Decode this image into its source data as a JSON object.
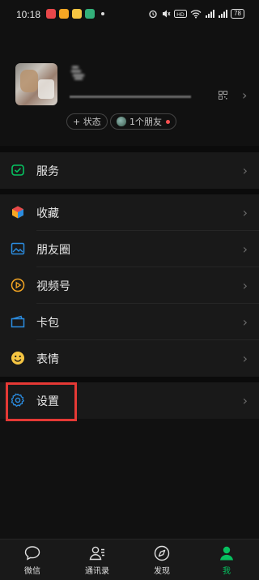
{
  "status_bar": {
    "time": "10:18",
    "battery": "78",
    "app_icon_colors": [
      "#e8474a",
      "#f5a623",
      "#f5c542",
      "#33b07a"
    ],
    "right_icons": [
      "alarm-icon",
      "mute-icon",
      "hd-icon",
      "wifi-icon",
      "signal-icon",
      "signal-icon",
      "battery-icon"
    ]
  },
  "profile": {
    "nickname": "",
    "wechat_id": "",
    "status_label": "+ 状态",
    "friends_label": "1个朋友",
    "unread_dot_color": "#fa5151"
  },
  "menu": {
    "services": {
      "label": "服务",
      "icon": "services-icon",
      "color": "#07c160"
    },
    "favorites": {
      "label": "收藏",
      "icon": "favorites-cube-icon"
    },
    "moments": {
      "label": "朋友圈",
      "icon": "moments-image-icon",
      "color": "#2b8ce0"
    },
    "channels": {
      "label": "视频号",
      "icon": "channels-play-icon",
      "color": "#f5a623"
    },
    "cards": {
      "label": "卡包",
      "icon": "card-wallet-icon",
      "color": "#2b8ce0"
    },
    "stickers": {
      "label": "表情",
      "icon": "sticker-smile-icon",
      "color": "#f5c542"
    },
    "settings": {
      "label": "设置",
      "icon": "settings-gear-icon",
      "color": "#2b8ce0"
    }
  },
  "highlight": {
    "target": "settings",
    "color": "#e53935"
  },
  "tabbar": {
    "tabs": [
      {
        "label": "微信",
        "icon": "chat-bubble-icon",
        "active": false
      },
      {
        "label": "通讯录",
        "icon": "contacts-icon",
        "active": false
      },
      {
        "label": "发现",
        "icon": "discover-compass-icon",
        "active": false
      },
      {
        "label": "我",
        "icon": "me-person-icon",
        "active": true
      }
    ],
    "active_color": "#07c160"
  }
}
